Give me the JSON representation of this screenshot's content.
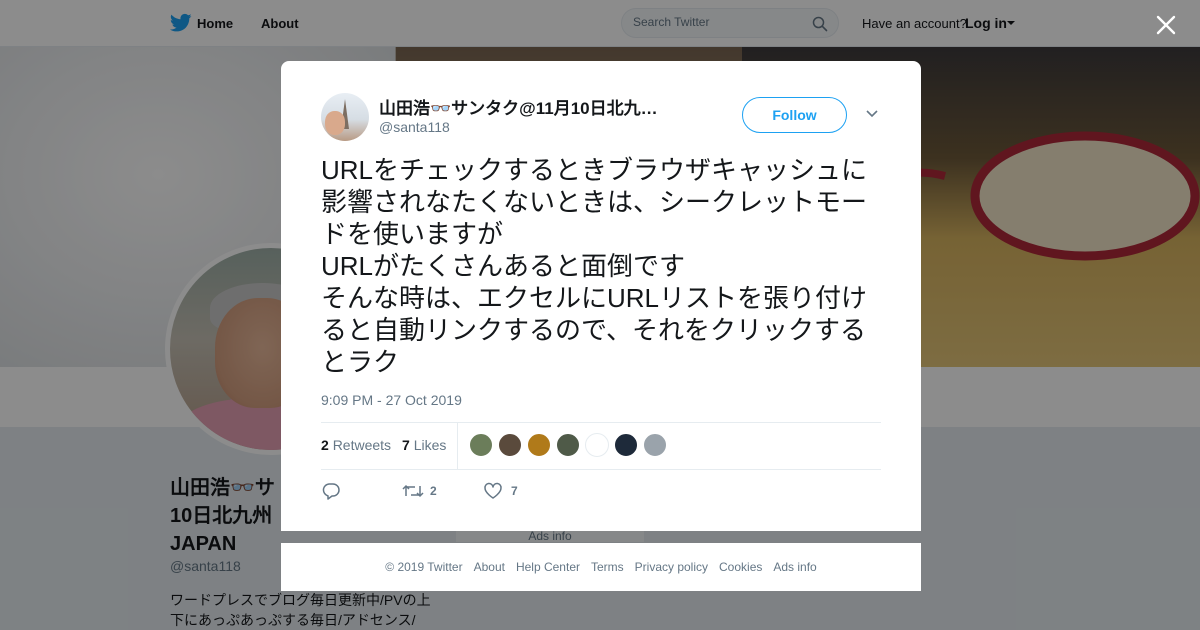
{
  "nav": {
    "home": "Home",
    "about": "About",
    "search_placeholder": "Search Twitter",
    "have_account": "Have an account?",
    "login": "Log in"
  },
  "profile": {
    "name_line1": "山田浩👓サ",
    "name_line2": "10日北九州",
    "name_line3": "JAPAN",
    "handle": "@santa118",
    "bio_line1": "ワードプレスでブログ毎日更新中/PVの上",
    "bio_line2": "下にあっぷあっぷする毎日/アドセンス/",
    "ads_info": "Ads info"
  },
  "tweet": {
    "author_name": "山田浩👓サンタク@11月10日北九…",
    "author_handle": "@santa118",
    "follow_label": "Follow",
    "text_lines": [
      "URLをチェックするときブラウザキャッシュに影響されなたくないときは、シークレットモードを使いますが",
      "URLがたくさんあると面倒です",
      "そんな時は、エクセルにURLリストを張り付けると自動リンクするので、それをクリックするとラク"
    ],
    "timestamp": "9:09 PM - 27 Oct 2019",
    "retweets_count": "2",
    "retweets_label": "Retweets",
    "likes_count": "7",
    "likes_label": "Likes",
    "action_retweet_count": "2",
    "action_like_count": "7",
    "liker_colors": [
      "#6b7d5a",
      "#5a4a3c",
      "#b07a1a",
      "#4f5a48",
      "#ffffff",
      "#1e2a3a",
      "#9aa3ab"
    ]
  },
  "footer": {
    "copyright": "© 2019 Twitter",
    "about": "About",
    "help": "Help Center",
    "terms": "Terms",
    "privacy": "Privacy policy",
    "cookies": "Cookies",
    "ads_info": "Ads info"
  },
  "colors": {
    "accent": "#1da1f2",
    "muted": "#657786",
    "text": "#14171a"
  }
}
